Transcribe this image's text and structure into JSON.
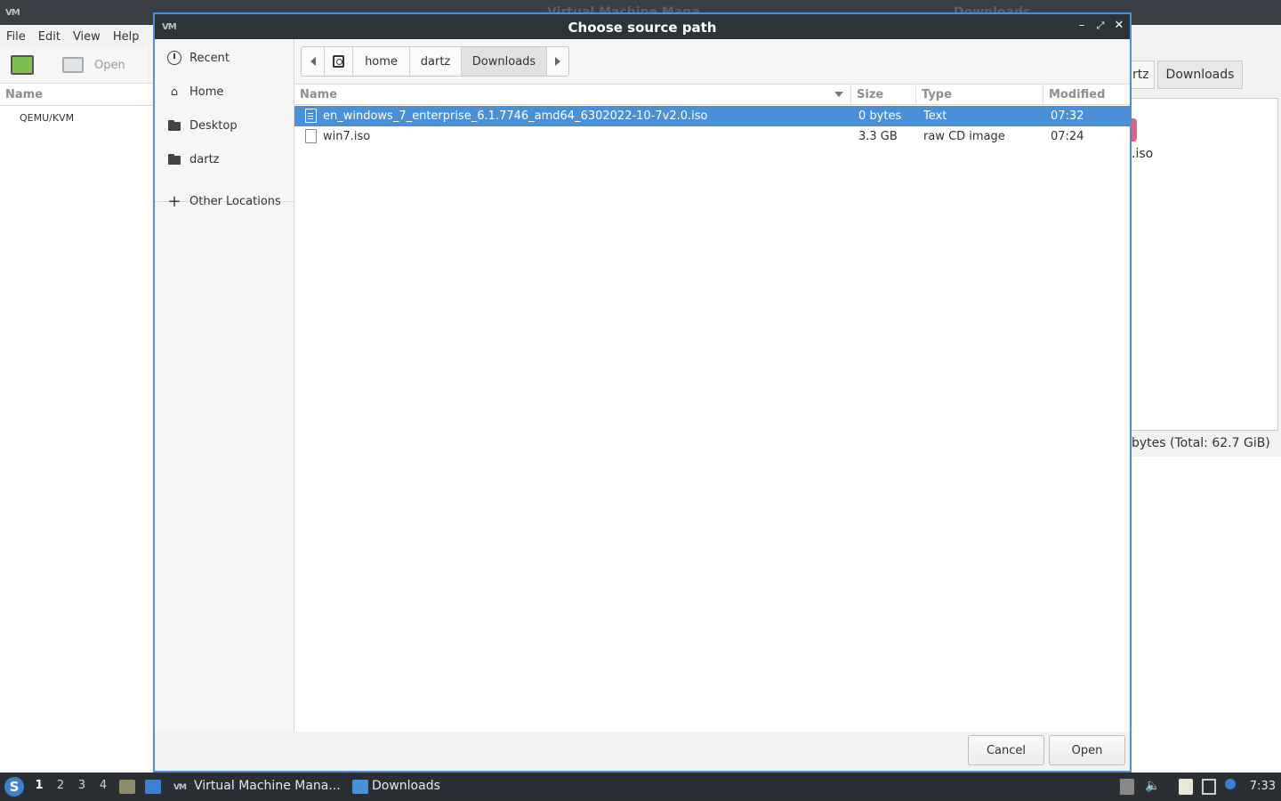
{
  "background": {
    "vmm": {
      "title": "Virtual Machine Mana...",
      "menu": [
        "File",
        "Edit",
        "View",
        "Help"
      ],
      "toolbar_open": "Open",
      "column_name": "Name",
      "connection": "QEMU/KVM"
    },
    "filemanager": {
      "title": "Downloads",
      "crumb_partial": "rtz",
      "crumb_current": "Downloads",
      "file_label": ".iso",
      "status": "bytes (Total: 62.7 GiB)"
    }
  },
  "dialog": {
    "title": "Choose source path",
    "places": [
      {
        "label": "Recent",
        "icon": "clock-icon"
      },
      {
        "label": "Home",
        "icon": "home-icon"
      },
      {
        "label": "Desktop",
        "icon": "folder-icon"
      },
      {
        "label": "dartz",
        "icon": "folder-icon"
      },
      {
        "label": "Other Locations",
        "icon": "plus-icon"
      }
    ],
    "path": [
      "home",
      "dartz",
      "Downloads"
    ],
    "columns": {
      "name": "Name",
      "size": "Size",
      "type": "Type",
      "modified": "Modified"
    },
    "files": [
      {
        "name": "en_windows_7_enterprise_6.1.7746_amd64_6302022-10-7v2.0.iso",
        "size": "0 bytes",
        "type": "Text",
        "modified": "07:32",
        "selected": true
      },
      {
        "name": "win7.iso",
        "size": "3.3 GB",
        "type": "raw CD image",
        "modified": "07:24",
        "selected": false
      }
    ],
    "cancel_label": "Cancel",
    "open_label": "Open"
  },
  "taskbar": {
    "workspaces": [
      "1",
      "2",
      "3",
      "4"
    ],
    "tasks": [
      {
        "label": "Virtual Machine Mana..."
      },
      {
        "label": "Downloads"
      }
    ],
    "clock": "7:33"
  },
  "colors": {
    "accent": "#4a90d9",
    "titlebar": "#2e3338",
    "taskbar": "#2b2f33"
  }
}
